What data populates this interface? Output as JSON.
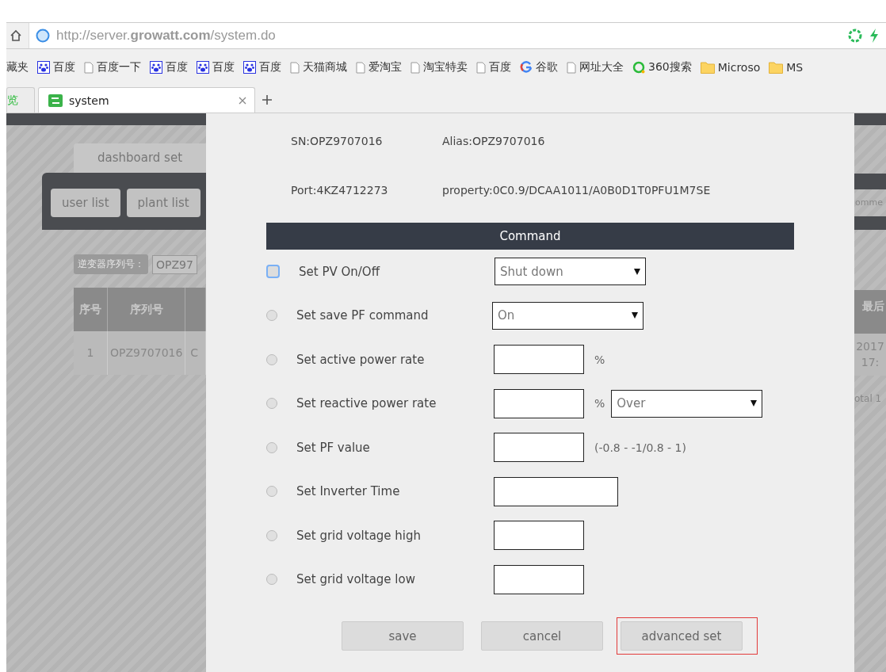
{
  "browser": {
    "url": "http://server.**growatt.com**/system.do",
    "bookmarks": [
      {
        "label": "藏夹",
        "kind": "none"
      },
      {
        "label": "百度",
        "kind": "paw"
      },
      {
        "label": "百度一下",
        "kind": "page"
      },
      {
        "label": "百度",
        "kind": "paw"
      },
      {
        "label": "百度",
        "kind": "paw"
      },
      {
        "label": "百度",
        "kind": "paw"
      },
      {
        "label": "天猫商城",
        "kind": "page"
      },
      {
        "label": "爱淘宝",
        "kind": "page"
      },
      {
        "label": "淘宝特卖",
        "kind": "page"
      },
      {
        "label": "百度",
        "kind": "page"
      },
      {
        "label": "谷歌",
        "kind": "google"
      },
      {
        "label": "网址大全",
        "kind": "page"
      },
      {
        "label": "360搜索",
        "kind": "ring"
      },
      {
        "label": "Microso",
        "kind": "folder"
      },
      {
        "label": "MS",
        "kind": "folder"
      }
    ],
    "tabs": [
      {
        "label": "览",
        "selected": false
      },
      {
        "label": "system",
        "selected": true
      }
    ]
  },
  "background_left": {
    "tab": "dashboard set",
    "buttons": [
      "user list",
      "plant list"
    ],
    "search_label": "逆变器序列号：",
    "search_value": "OPZ97",
    "table": {
      "columns": [
        "序号",
        "序列号"
      ],
      "rows": [
        [
          "1",
          "OPZ9707016",
          "C"
        ]
      ]
    }
  },
  "background_right": {
    "button": "omme",
    "column": "最后",
    "cell_lines": [
      "2017",
      "17:"
    ],
    "total": "otal 1"
  },
  "dialog": {
    "info": [
      [
        "SN:OPZ9707016",
        "Alias:OPZ9707016"
      ],
      [
        "Port:4KZ4712273",
        "property:0C0.9/DCAA1011/A0B0D1T0PFU1M7SE"
      ]
    ],
    "header": "Command",
    "rows": [
      {
        "label": "Set PV On/Off",
        "selected": true,
        "kind": "select",
        "value": "Shut down"
      },
      {
        "label": "Set save PF command",
        "selected": false,
        "kind": "select",
        "value": "On"
      },
      {
        "label": "Set active power rate",
        "selected": false,
        "kind": "input",
        "suffix": "%"
      },
      {
        "label": "Set reactive power rate",
        "selected": false,
        "kind": "input_select",
        "suffix": "%",
        "value": "Over"
      },
      {
        "label": "Set PF value",
        "selected": false,
        "kind": "input",
        "suffix": "(-0.8 - -1/0.8 - 1)"
      },
      {
        "label": "Set Inverter Time",
        "selected": false,
        "kind": "wide_input"
      },
      {
        "label": "Set grid voltage high",
        "selected": false,
        "kind": "input"
      },
      {
        "label": "Set grid voltage low",
        "selected": false,
        "kind": "input"
      }
    ],
    "buttons": [
      {
        "label": "save",
        "highlighted": false
      },
      {
        "label": "cancel",
        "highlighted": false
      },
      {
        "label": "advanced set",
        "highlighted": true
      }
    ]
  }
}
